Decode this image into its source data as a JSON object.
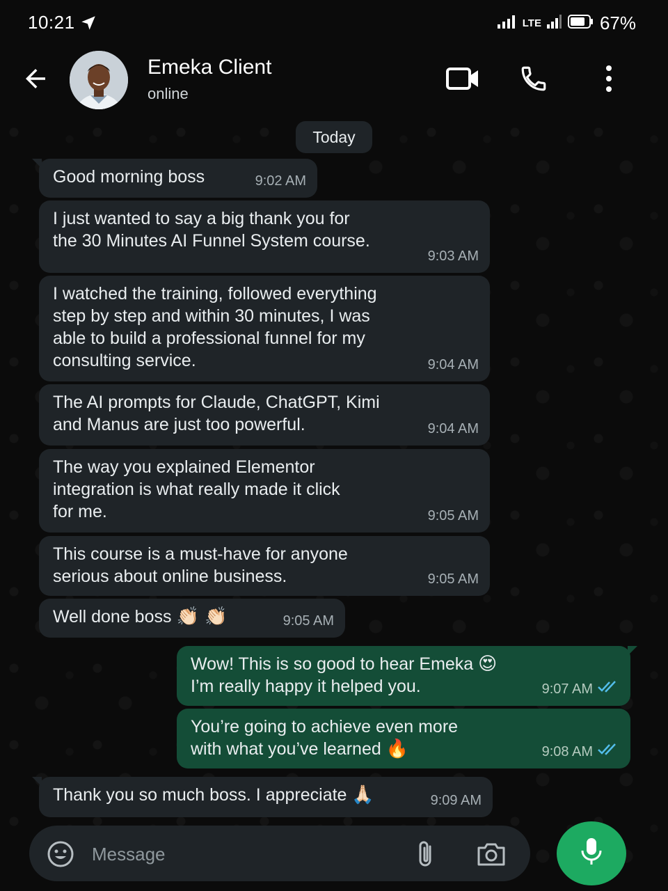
{
  "status_bar": {
    "time": "10:21",
    "network": "LTE",
    "battery": "67%"
  },
  "header": {
    "contact_name": "Emeka Client",
    "contact_status": "online"
  },
  "date_chip": "Today",
  "messages": [
    {
      "direction": "in",
      "text": "Good morning boss",
      "time": "9:02 AM"
    },
    {
      "direction": "in",
      "text": "I just wanted to say a big thank you for\nthe 30 Minutes AI Funnel System course.",
      "time": "9:03 AM"
    },
    {
      "direction": "in",
      "text": "I watched the training, followed everything\nstep by step and within 30 minutes, I was\nable to build a professional funnel for my\nconsulting service.",
      "time": "9:04 AM"
    },
    {
      "direction": "in",
      "text": "The AI prompts for Claude, ChatGPT, Kimi\nand Manus are just too powerful.",
      "time": "9:04 AM"
    },
    {
      "direction": "in",
      "text": "The way you explained Elementor\nintegration is what really made it click\nfor me.",
      "time": "9:05 AM"
    },
    {
      "direction": "in",
      "text": "This course is a must-have for anyone\nserious about online business.",
      "time": "9:05 AM"
    },
    {
      "direction": "in",
      "text": "Well done boss",
      "emoji": "👏🏻 👏🏻",
      "time": "9:05 AM"
    },
    {
      "direction": "out",
      "text": "Wow! This is so good to hear Emeka",
      "emoji": "😍",
      "text2": "I’m really happy it helped you.",
      "time": "9:07 AM",
      "status": "read"
    },
    {
      "direction": "out",
      "text": "You’re going to achieve even more\nwith what you’ve learned",
      "emoji": "🔥",
      "time": "9:08 AM",
      "status": "read"
    },
    {
      "direction": "in",
      "text": "Thank you so much boss. I appreciate",
      "emoji": "🙏🏻",
      "time": "9:09 AM"
    }
  ],
  "composer": {
    "placeholder": "Message"
  },
  "colors": {
    "background": "#0b0b0b",
    "incoming_bubble": "#1f2428",
    "outgoing_bubble": "#144d37",
    "read_tick": "#53bdeb",
    "mic_button": "#1daa61"
  },
  "icons": [
    "navigation-arrow-icon",
    "signal-icon",
    "battery-icon",
    "back-arrow-icon",
    "video-call-icon",
    "phone-icon",
    "more-options-icon",
    "emoji-icon",
    "attach-icon",
    "camera-icon",
    "mic-icon",
    "double-check-icon"
  ]
}
